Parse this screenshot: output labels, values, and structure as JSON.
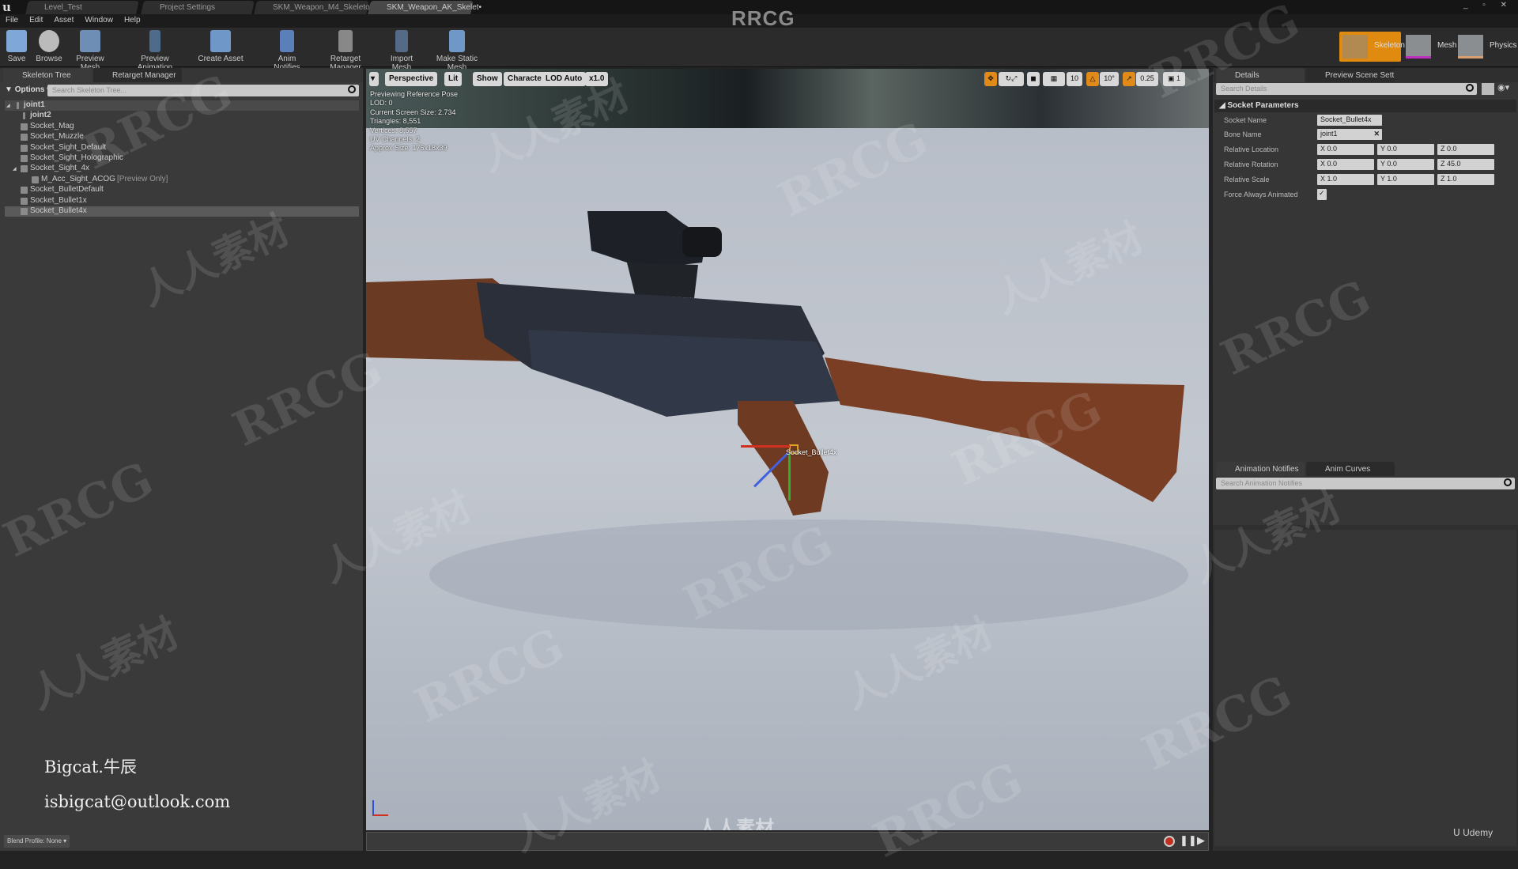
{
  "app": {
    "title": "RRCG",
    "logo": "unreal-logo"
  },
  "doc_tabs": [
    {
      "label": "Level_Test"
    },
    {
      "label": "Project Settings"
    },
    {
      "label": "SKM_Weapon_M4_Skeleto"
    },
    {
      "label": "SKM_Weapon_AK_Skelet•"
    }
  ],
  "menu": [
    "File",
    "Edit",
    "Asset",
    "Window",
    "Help"
  ],
  "toolbar": [
    {
      "label": "Save",
      "icon": "save-icon"
    },
    {
      "label": "Browse",
      "icon": "browse-icon"
    },
    {
      "label": "Preview Mesh",
      "icon": "preview-mesh-icon"
    },
    {
      "label": "Preview Animation",
      "icon": "preview-animation-icon"
    },
    {
      "label": "Create Asset",
      "icon": "create-asset-icon"
    },
    {
      "label": "Anim Notifies",
      "icon": "anim-notifies-icon"
    },
    {
      "label": "Retarget Manager",
      "icon": "retarget-manager-icon"
    },
    {
      "label": "Import Mesh",
      "icon": "import-mesh-icon"
    },
    {
      "label": "Make Static Mesh",
      "icon": "make-static-mesh-icon"
    }
  ],
  "modes": [
    {
      "label": "Skeleton",
      "active": true
    },
    {
      "label": "Mesh"
    },
    {
      "label": "Physics"
    }
  ],
  "left": {
    "tabs": [
      "Skeleton Tree",
      "Retarget Manager"
    ],
    "options_label": "Options",
    "search_placeholder": "Search Skeleton Tree...",
    "tree": [
      {
        "label": "joint1",
        "type": "bone",
        "bold": true
      },
      {
        "label": "joint2",
        "type": "bone",
        "bold": true
      },
      {
        "label": "Socket_Mag",
        "type": "socket"
      },
      {
        "label": "Socket_Muzzle",
        "type": "socket"
      },
      {
        "label": "Socket_Sight_Default",
        "type": "socket"
      },
      {
        "label": "Socket_Sight_Holographic",
        "type": "socket"
      },
      {
        "label": "Socket_Sight_4x",
        "type": "socket"
      },
      {
        "label": "M_Acc_Sight_ACOG",
        "suffix": "[Preview Only]",
        "type": "mesh"
      },
      {
        "label": "Socket_BulletDefault",
        "type": "socket"
      },
      {
        "label": "Socket_Bullet1x",
        "type": "socket"
      },
      {
        "label": "Socket_Bullet4x",
        "type": "socket",
        "selected": true
      }
    ],
    "credit_name": "Bigcat.牛辰",
    "credit_email": "isbigcat@outlook.com",
    "blend_profile": "Blend Profile: None"
  },
  "viewport": {
    "buttons": [
      "Perspective",
      "Lit",
      "Show",
      "Character",
      "LOD Auto",
      "x1.0"
    ],
    "info": [
      "Previewing Reference Pose",
      "LOD: 0",
      "Current Screen Size: 2.734",
      "Triangles: 8,551",
      "Vertices: 8,557",
      "UV Channels: 2",
      "Approx Size: 175x18x39"
    ],
    "right_buttons": {
      "grid_snap": "10",
      "rot_snap": "10°",
      "scale_snap": "0.25",
      "camera_speed": "1"
    },
    "socket_label": "Socket_Bullet4x",
    "watermark_logo": "人人素材"
  },
  "details": {
    "tabs": [
      "Details",
      "Preview Scene Sett"
    ],
    "search_placeholder": "Search Details",
    "section": "Socket Parameters",
    "socket_name_label": "Socket Name",
    "socket_name": "Socket_Bullet4x",
    "bone_name_label": "Bone Name",
    "bone_name": "joint1",
    "location_label": "Relative Location",
    "location": [
      "X 0.0",
      "Y 0.0",
      "Z 0.0"
    ],
    "rotation_label": "Relative Rotation",
    "rotation": [
      "X 0.0",
      "Y 0.0",
      "Z 45.0"
    ],
    "scale_label": "Relative Scale",
    "scale": [
      "X 1.0",
      "Y 1.0",
      "Z 1.0"
    ],
    "force_label": "Force Always Animated",
    "force_checked": true
  },
  "notifies": {
    "tabs": [
      "Animation Notifies",
      "Anim Curves"
    ],
    "search_placeholder": "Search Animation Notifies"
  },
  "brand": "Udemy"
}
